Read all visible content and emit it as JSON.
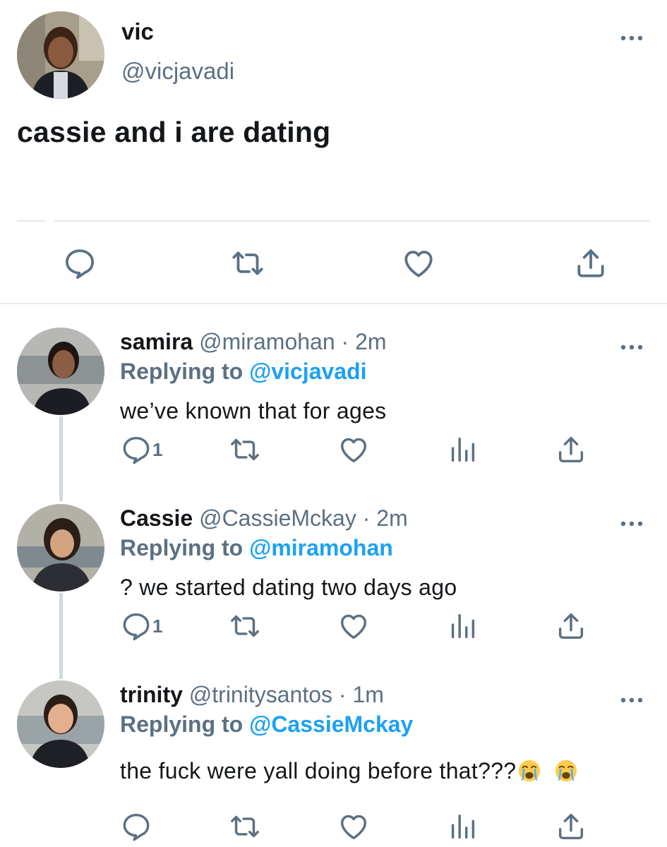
{
  "main_tweet": {
    "name": "vic",
    "handle": "@vicjavadi",
    "text": "cassie and i are dating",
    "avatar": "profile-photo-vic"
  },
  "replies": [
    {
      "name": "samira",
      "handle": "@miramohan",
      "dot": "·",
      "time": "2m",
      "replying_label": "Replying to",
      "replying_to": "@vicjavadi",
      "text": "we’ve known that for ages",
      "reply_count": "1",
      "avatar": "profile-photo-samira"
    },
    {
      "name": "Cassie",
      "handle": "@CassieMckay",
      "dot": "·",
      "time": "2m",
      "replying_label": "Replying to",
      "replying_to": "@miramohan",
      "text": "? we started dating two days ago",
      "reply_count": "1",
      "avatar": "profile-photo-cassie"
    },
    {
      "name": "trinity",
      "handle": "@trinitysantos",
      "dot": "·",
      "time": "1m",
      "replying_label": "Replying to",
      "replying_to": "@CassieMckay",
      "text": "the fuck were yall doing before that???",
      "emojis": [
        "loudly-crying-face",
        "loudly-crying-face"
      ],
      "reply_count": "",
      "avatar": "profile-photo-trinity"
    }
  ],
  "icons": {
    "reply": "reply-icon",
    "retweet": "retweet-icon",
    "like": "heart-icon",
    "share": "share-icon",
    "analytics": "analytics-icon",
    "more": "more-icon"
  },
  "colors": {
    "text": "#14171a",
    "secondary": "#5b7083",
    "mention": "#1da1f2",
    "divider": "#e1e8ed",
    "thread_line": "#cfd9de"
  }
}
